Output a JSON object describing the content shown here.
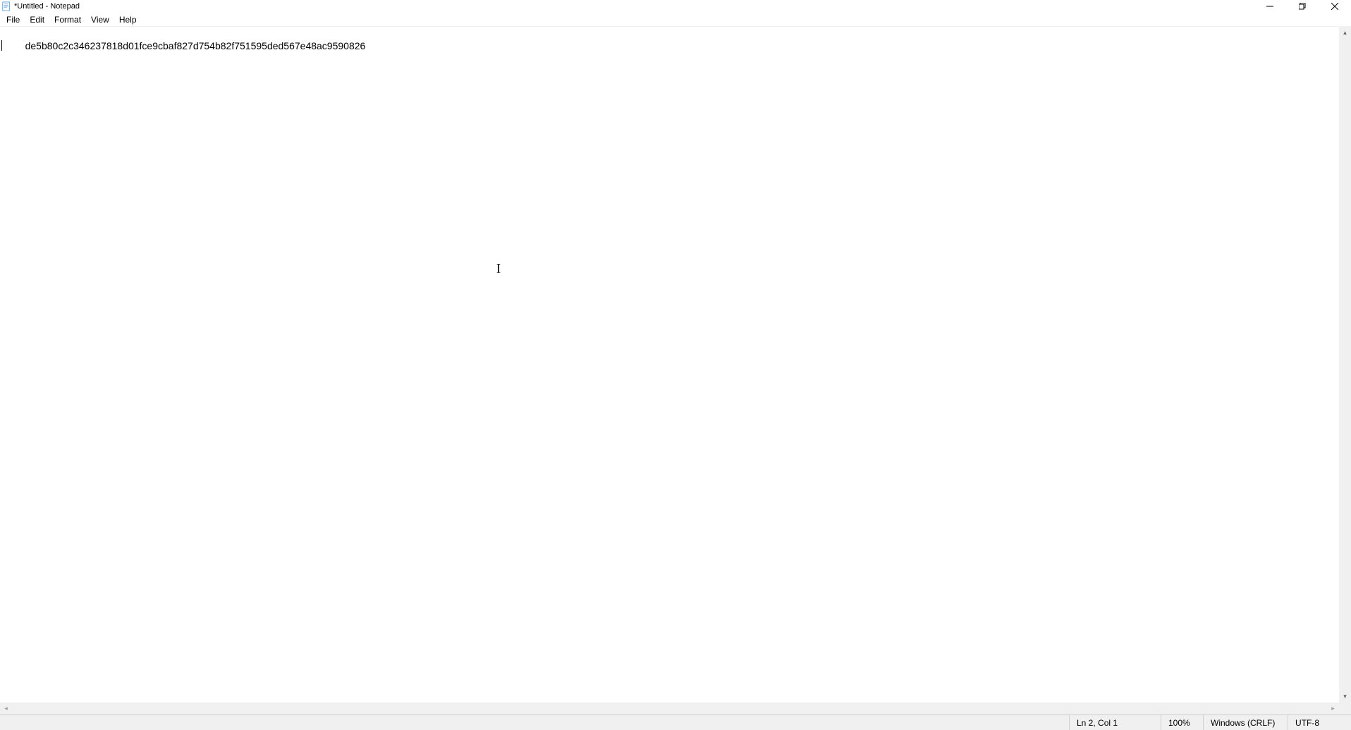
{
  "titlebar": {
    "title": "*Untitled - Notepad"
  },
  "menu": {
    "file": "File",
    "edit": "Edit",
    "format": "Format",
    "view": "View",
    "help": "Help"
  },
  "editor": {
    "content": "de5b80c2c346237818d01fce9cbaf827d754b82f751595ded567e48ac9590826"
  },
  "statusbar": {
    "position": "Ln 2, Col 1",
    "zoom": "100%",
    "line_ending": "Windows (CRLF)",
    "encoding": "UTF-8"
  }
}
